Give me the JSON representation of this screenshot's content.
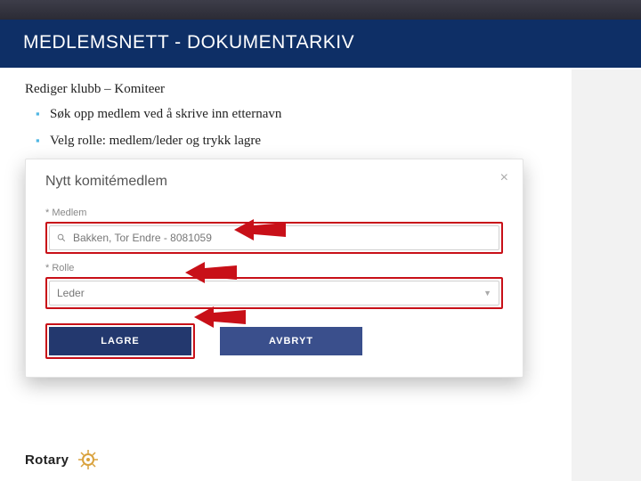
{
  "header": {
    "title": "MEDLEMSNETT - DOKUMENTARKIV"
  },
  "content": {
    "subtitle": "Rediger klubb – Komiteer",
    "bullets": [
      "Søk opp medlem ved å skrive inn etternavn",
      "Velg rolle: medlem/leder og trykk lagre"
    ]
  },
  "panel": {
    "title": "Nytt komitémedlem",
    "close": "×",
    "fields": {
      "member": {
        "label": "* Medlem",
        "value": "Bakken, Tor Endre - 8081059"
      },
      "role": {
        "label": "* Rolle",
        "value": "Leder"
      }
    },
    "buttons": {
      "save": "LAGRE",
      "cancel": "AVBRYT"
    }
  },
  "footer": {
    "brand": "Rotary"
  }
}
